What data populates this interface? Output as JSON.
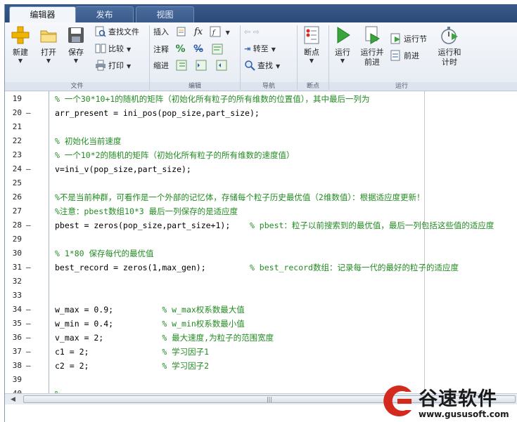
{
  "tabs": [
    {
      "label": "编辑器",
      "active": true
    },
    {
      "label": "发布",
      "active": false
    },
    {
      "label": "视图",
      "active": false
    }
  ],
  "ribbon": {
    "file": {
      "new_label": "新建",
      "open_label": "打开",
      "save_label": "保存",
      "find_files_label": "查找文件",
      "compare_label": "比较",
      "print_label": "打印",
      "group_label": "文件"
    },
    "edit": {
      "insert_label": "插入",
      "comment_label": "注释",
      "indent_label": "缩进",
      "group_label": "编辑"
    },
    "navigate": {
      "goto_label": "转至",
      "find_label": "查找",
      "group_label": "导航"
    },
    "breakpoints": {
      "breakpoints_label": "断点",
      "group_label": "断点"
    },
    "run": {
      "run_label": "运行",
      "run_advance_label1": "运行并",
      "run_advance_label2": "前进",
      "run_section_label": "运行节",
      "advance_label": "前进",
      "run_time_label1": "运行和",
      "run_time_label2": "计时",
      "group_label": "运行"
    }
  },
  "editor": {
    "lines": [
      {
        "num": "19",
        "dash": "",
        "code": "",
        "comment": "% 一个30*10+1的随机的矩阵（初始化所有粒子的所有维数的位置值），其中最后一列为"
      },
      {
        "num": "20",
        "dash": "—",
        "code": "arr_present = ini_pos(pop_size,part_size);",
        "comment": ""
      },
      {
        "num": "21",
        "dash": "",
        "code": "",
        "comment": ""
      },
      {
        "num": "22",
        "dash": "",
        "code": "",
        "comment": "% 初始化当前速度"
      },
      {
        "num": "23",
        "dash": "",
        "code": "",
        "comment": "% 一个10*2的随机的矩阵（初始化所有粒子的所有维数的速度值）"
      },
      {
        "num": "24",
        "dash": "—",
        "code": "v=ini_v(pop_size,part_size);",
        "comment": ""
      },
      {
        "num": "25",
        "dash": "",
        "code": "",
        "comment": ""
      },
      {
        "num": "26",
        "dash": "",
        "code": "",
        "comment": "%不是当前种群，可看作是一个外部的记忆体，存储每个粒子历史最优值（2维数值）：根据适应度更新！"
      },
      {
        "num": "27",
        "dash": "",
        "code": "",
        "comment": "%注意：pbest数组10*3  最后一列保存的是适应度"
      },
      {
        "num": "28",
        "dash": "—",
        "code": "pbest = zeros(pop_size,part_size+1);    ",
        "comment": "% pbest：粒子以前搜索到的最优值，最后一列包括这些值的适应度"
      },
      {
        "num": "29",
        "dash": "",
        "code": "",
        "comment": ""
      },
      {
        "num": "30",
        "dash": "",
        "code": "",
        "comment": "% 1*80 保存每代的最优值"
      },
      {
        "num": "31",
        "dash": "—",
        "code": "best_record = zeros(1,max_gen);         ",
        "comment": "% best_record数组：记录每一代的最好的粒子的适应度"
      },
      {
        "num": "32",
        "dash": "",
        "code": "",
        "comment": ""
      },
      {
        "num": "33",
        "dash": "",
        "code": "",
        "comment": ""
      },
      {
        "num": "34",
        "dash": "—",
        "code": "w_max = 0.9;          ",
        "comment": "%  w_max权系数最大值"
      },
      {
        "num": "35",
        "dash": "—",
        "code": "w_min = 0.4;          ",
        "comment": "%  w_min权系数最小值"
      },
      {
        "num": "36",
        "dash": "—",
        "code": "v_max = 2;            ",
        "comment": "%  最大速度,为粒子的范围宽度"
      },
      {
        "num": "37",
        "dash": "—",
        "code": "c1 = 2;               ",
        "comment": "%  学习因子1"
      },
      {
        "num": "38",
        "dash": "—",
        "code": "c2 = 2;               ",
        "comment": "%  学习因子2"
      },
      {
        "num": "39",
        "dash": "",
        "code": "",
        "comment": ""
      },
      {
        "num": "40",
        "dash": "",
        "code": "",
        "comment": "%"
      }
    ]
  },
  "watermark": {
    "name": "谷速软件",
    "url": "www.gususoft.com"
  },
  "colors": {
    "comment": "#228b22",
    "tabstrip": "#2b4a78",
    "ribbon": "#e5ebf3"
  }
}
